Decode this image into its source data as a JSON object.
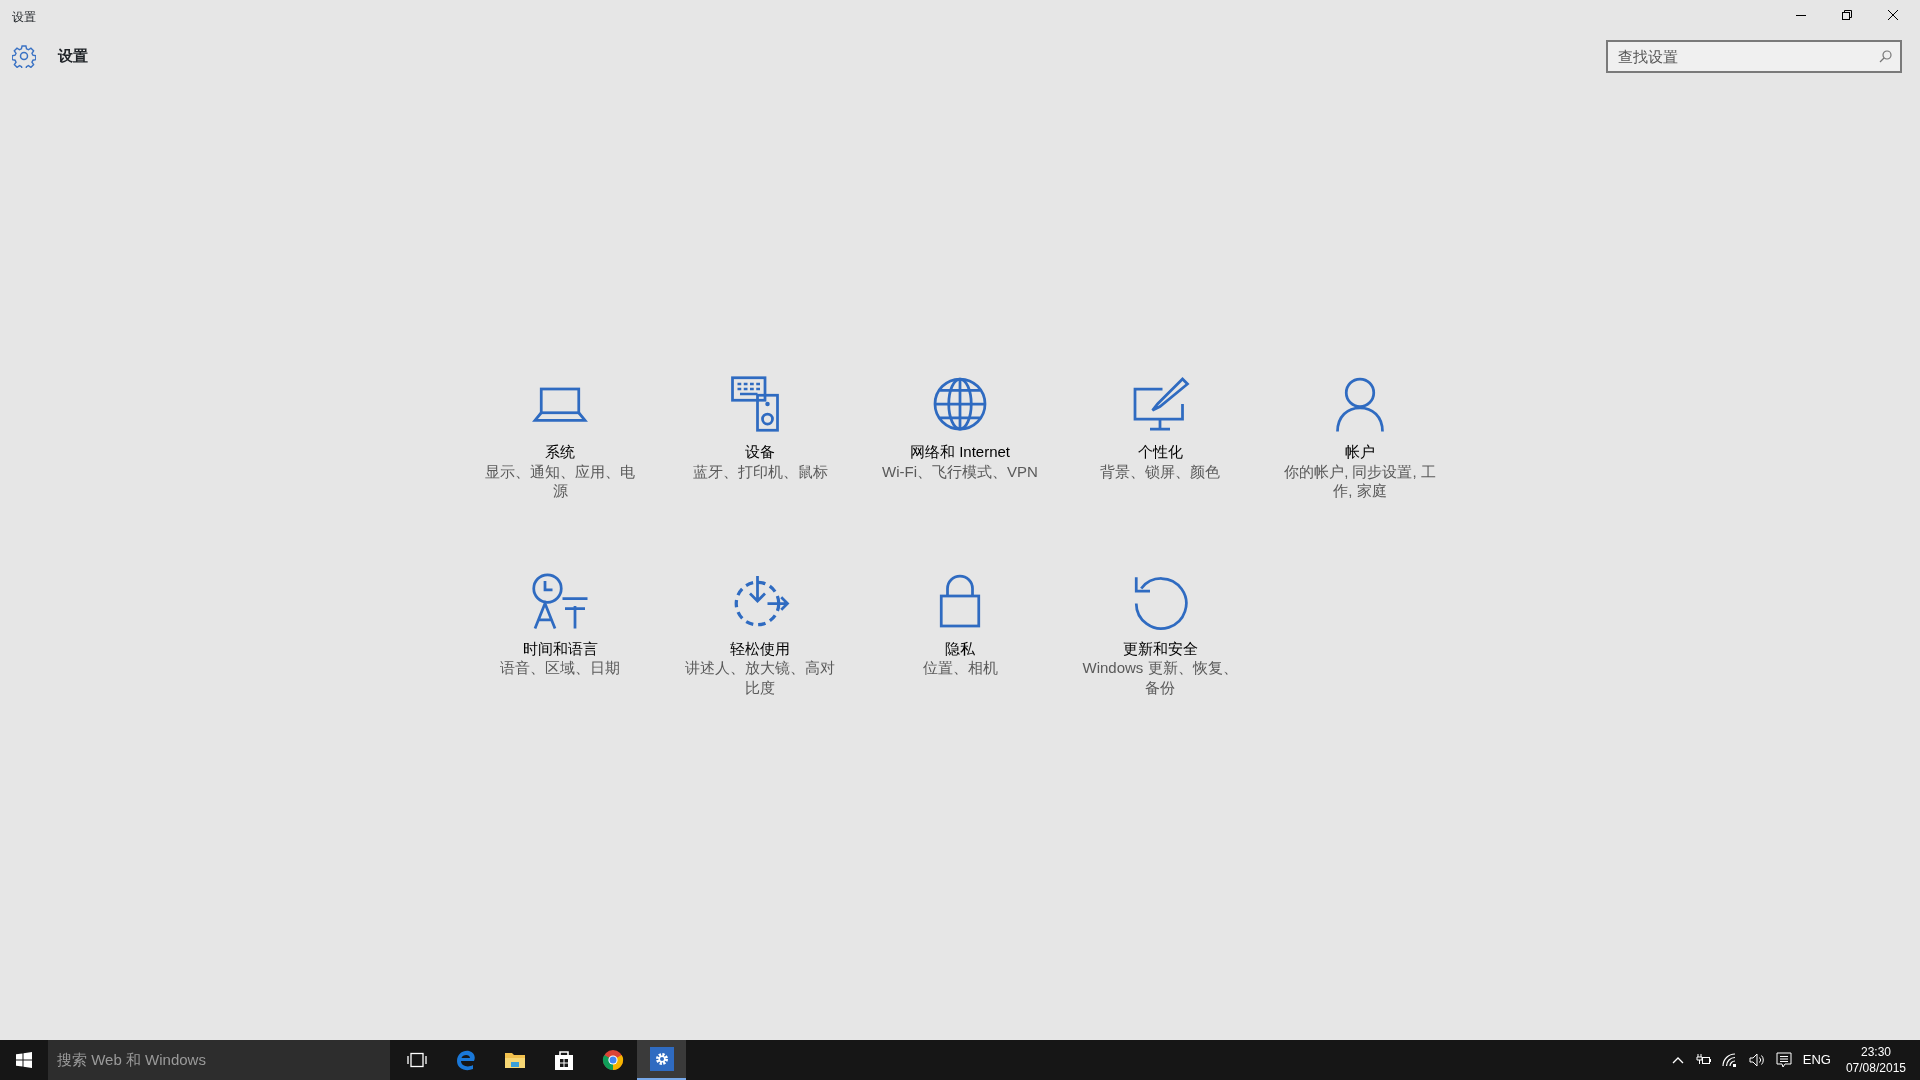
{
  "window": {
    "title": "设置"
  },
  "header": {
    "title": "设置"
  },
  "search": {
    "placeholder": "查找设置"
  },
  "tiles": [
    {
      "title": "系统",
      "subtitle": "显示、通知、应用、电源"
    },
    {
      "title": "设备",
      "subtitle": "蓝牙、打印机、鼠标"
    },
    {
      "title": "网络和 Internet",
      "subtitle": "Wi-Fi、飞行模式、VPN"
    },
    {
      "title": "个性化",
      "subtitle": "背景、锁屏、颜色"
    },
    {
      "title": "帐户",
      "subtitle": "你的帐户, 同步设置, 工作, 家庭"
    },
    {
      "title": "时间和语言",
      "subtitle": "语音、区域、日期"
    },
    {
      "title": "轻松使用",
      "subtitle": "讲述人、放大镜、高对比度"
    },
    {
      "title": "隐私",
      "subtitle": "位置、相机"
    },
    {
      "title": "更新和安全",
      "subtitle": "Windows 更新、恢复、备份"
    }
  ],
  "taskbar": {
    "search_placeholder": "搜索 Web 和 Windows",
    "apps": [
      {
        "selected": false
      },
      {
        "selected": false
      },
      {
        "selected": false
      },
      {
        "selected": false
      },
      {
        "selected": false
      },
      {
        "selected": true
      }
    ],
    "language": "ENG",
    "time": "23:30",
    "date": "07/08/2015"
  }
}
